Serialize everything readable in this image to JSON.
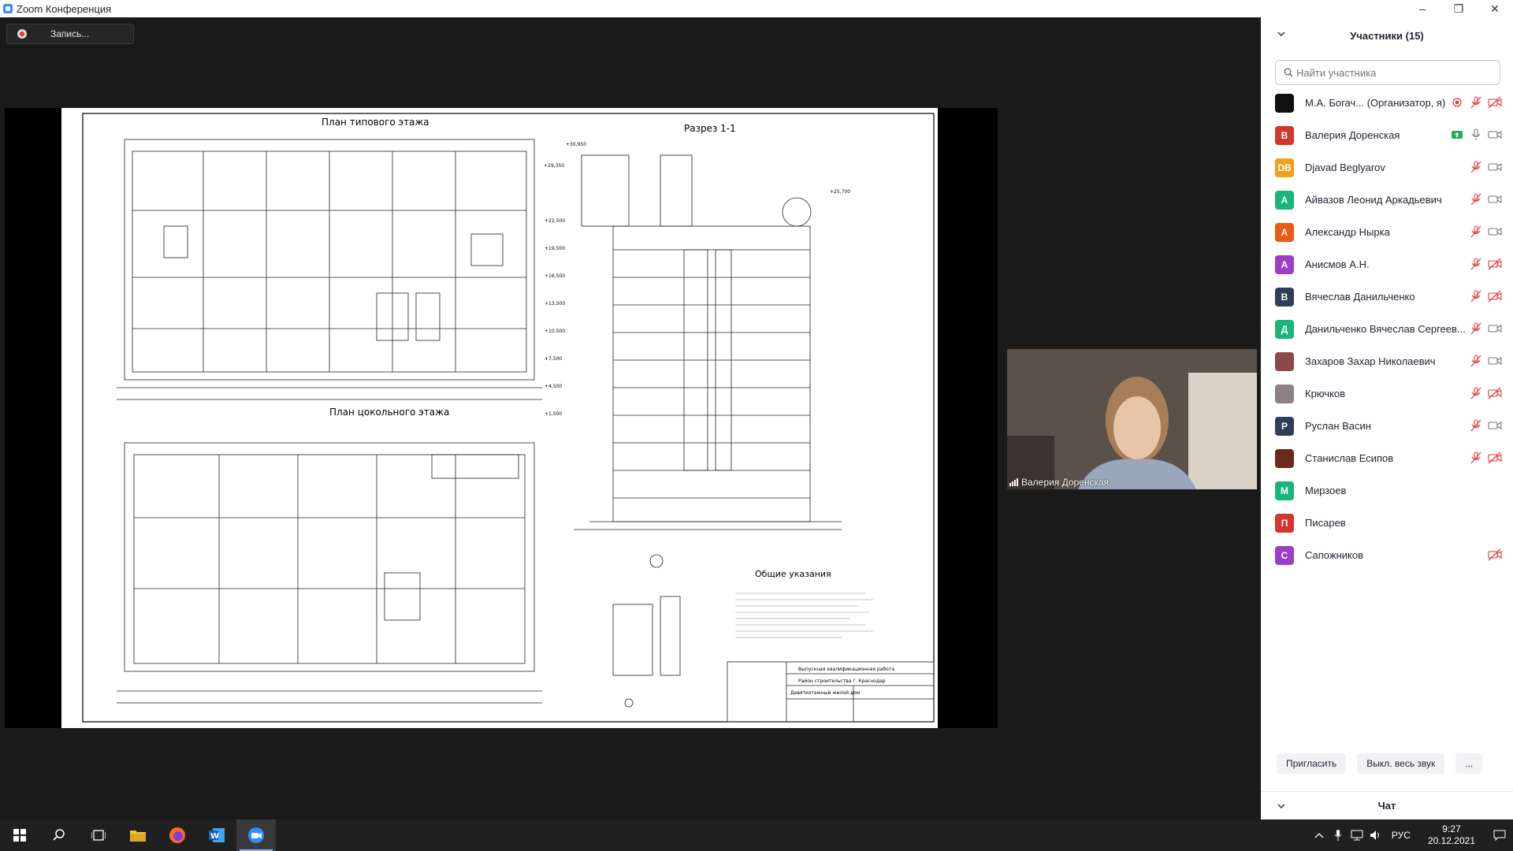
{
  "window": {
    "title": "Zoom Конференция",
    "minimize": "–",
    "maximize": "❐",
    "close": "✕"
  },
  "recording": {
    "label": "Запись..."
  },
  "video": {
    "name": "Валерия Доренская"
  },
  "panel": {
    "title": "Участники (15)",
    "search_placeholder": "Найти участника",
    "participants": [
      {
        "initials": "",
        "name": "М.А. Богач... (Организатор, я)",
        "color": "#111111",
        "icons": [
          "rec-icon",
          "mic-muted-icon",
          "video-off-icon"
        ]
      },
      {
        "initials": "В",
        "name": "Валерия Доренская",
        "color": "#d2362c",
        "icons": [
          "share-icon",
          "mic-icon",
          "video-icon"
        ]
      },
      {
        "initials": "DB",
        "name": "Djavad Beglyarov",
        "color": "#f0a01c",
        "icons": [
          "mic-muted-icon",
          "video-icon"
        ]
      },
      {
        "initials": "А",
        "name": "Айвазов Леонид Аркадьевич",
        "color": "#1bb57a",
        "icons": [
          "mic-muted-icon",
          "video-icon"
        ]
      },
      {
        "initials": "А",
        "name": "Александр Нырка",
        "color": "#ec5a13",
        "icons": [
          "mic-muted-icon",
          "video-icon"
        ]
      },
      {
        "initials": "А",
        "name": "Анисмов А.Н.",
        "color": "#9b3fc7",
        "icons": [
          "mic-muted-icon",
          "video-off-icon"
        ]
      },
      {
        "initials": "В",
        "name": "Вячеслав Данильченко",
        "color": "#2f3e58",
        "icons": [
          "mic-muted-icon",
          "video-off-icon"
        ]
      },
      {
        "initials": "Д",
        "name": "Данильченко Вячеслав Сергеев...",
        "color": "#1bb57a",
        "icons": [
          "mic-muted-icon",
          "video-icon"
        ]
      },
      {
        "initials": "",
        "name": "Захаров Захар Николаевич",
        "color": "#8a4a4a",
        "icons": [
          "mic-muted-icon",
          "video-icon"
        ]
      },
      {
        "initials": "",
        "name": "Крючков",
        "color": "#8f7f86",
        "icons": [
          "mic-muted-icon",
          "video-off-icon"
        ]
      },
      {
        "initials": "Р",
        "name": "Руслан Васин",
        "color": "#2f3e58",
        "icons": [
          "mic-muted-icon",
          "video-icon"
        ]
      },
      {
        "initials": "",
        "name": "Станислав Есипов",
        "color": "#6a2b1e",
        "icons": [
          "mic-muted-icon",
          "video-off-icon"
        ]
      },
      {
        "initials": "М",
        "name": "Мирзоев",
        "color": "#1bb57a",
        "icons": []
      },
      {
        "initials": "П",
        "name": "Писарев",
        "color": "#d2362c",
        "icons": []
      },
      {
        "initials": "С",
        "name": "Сапожников",
        "color": "#9b3fc7",
        "icons": [
          "video-off-icon"
        ]
      }
    ],
    "invite": "Пригласить",
    "mute_all": "Выкл. весь звук",
    "more": "...",
    "chat": "Чат"
  },
  "drawing": {
    "title_typical": "План типового этажа",
    "title_basement": "План цокольного этажа",
    "title_section": "Разрез 1-1",
    "title_notes": "Общие указания",
    "stamp_line1": "Выпускная квалификационная работа",
    "stamp_line2": "Район строительства г. Краснодар",
    "stamp_line3": "Девятиэтажный жилой дом",
    "elevations": [
      "+30,950",
      "+29,350",
      "+25,700",
      "+22,500",
      "+19,500",
      "+16,500",
      "+13,500",
      "+10,500",
      "+7,500",
      "+4,500",
      "+1,500"
    ]
  },
  "taskbar": {
    "time": "9:27",
    "date": "20.12.2021",
    "lang": "РУС"
  }
}
